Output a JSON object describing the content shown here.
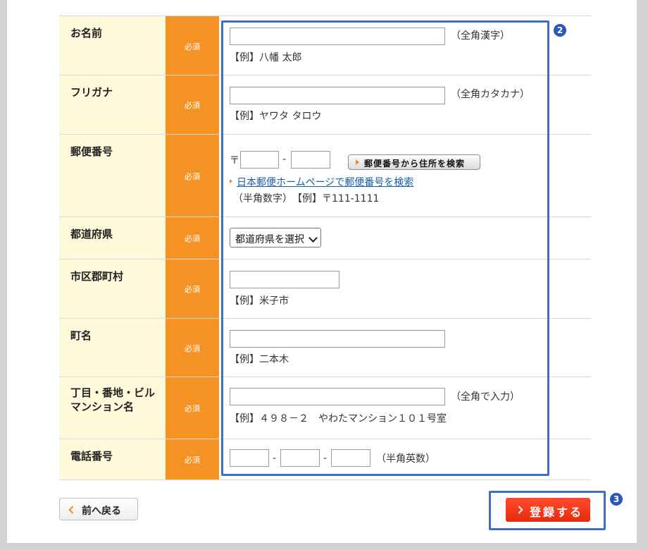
{
  "form": {
    "required_badge": "必須",
    "rows": {
      "name": {
        "label": "お名前",
        "hint": "（全角漢字）",
        "example": "【例】八幡 太郎"
      },
      "kana": {
        "label": "フリガナ",
        "hint": "（全角カタカナ）",
        "example": "【例】ヤワタ タロウ"
      },
      "postal": {
        "label": "郵便番号",
        "prefix": "〒",
        "sep": "-",
        "search_button": "郵便番号から住所を検索",
        "link": "日本郵便ホームページで郵便番号を検索",
        "note": "（半角数字）　【例】〒111-1111"
      },
      "prefecture": {
        "label": "都道府県",
        "select_value": "都道府県を選択"
      },
      "city": {
        "label": "市区郡町村",
        "example": "【例】米子市"
      },
      "town": {
        "label": "町名",
        "example": "【例】二本木"
      },
      "address": {
        "label_line1": "丁目・番地・ビル",
        "label_line2": "マンション名",
        "hint": "（全角で入力）",
        "example": "【例】４９８－２　やわたマンション１０１号室"
      },
      "phone": {
        "label": "電話番号",
        "sep": "-",
        "hint": "（半角英数）"
      }
    }
  },
  "annotations": {
    "badge_2": "2",
    "badge_3": "3"
  },
  "actions": {
    "back_label": "前へ戻る",
    "register_label": "登録する"
  },
  "colors": {
    "label_bg": "#fff9dc",
    "required_bg": "#f49324",
    "highlight": "#3a6fc4",
    "register_bg": "#e82a0e",
    "link": "#1a5dab"
  }
}
